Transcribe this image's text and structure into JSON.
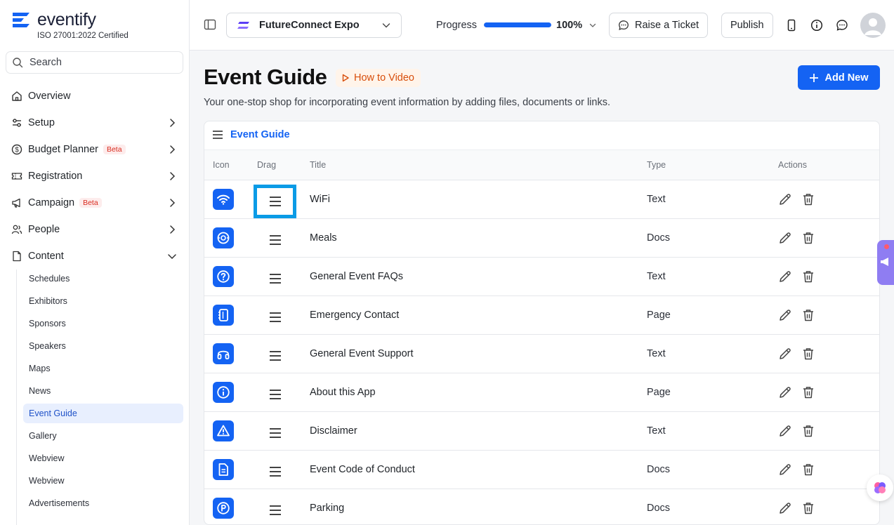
{
  "brand": {
    "name": "eventify",
    "certification": "ISO 27001:2022 Certified"
  },
  "sidebar": {
    "search_placeholder": "Search",
    "items": [
      {
        "label": "Overview",
        "icon": "home-icon"
      },
      {
        "label": "Setup",
        "icon": "sliders-icon"
      },
      {
        "label": "Budget Planner",
        "icon": "dollar-icon",
        "badge": "Beta"
      },
      {
        "label": "Registration",
        "icon": "ticket-icon"
      },
      {
        "label": "Campaign",
        "icon": "megaphone-icon",
        "badge": "Beta"
      },
      {
        "label": "People",
        "icon": "people-icon"
      },
      {
        "label": "Content",
        "icon": "document-icon"
      }
    ],
    "content_subitems": [
      "Schedules",
      "Exhibitors",
      "Sponsors",
      "Speakers",
      "Maps",
      "News",
      "Event Guide",
      "Gallery",
      "Webview",
      "Webview",
      "Advertisements"
    ],
    "active_subitem": "Event Guide"
  },
  "topbar": {
    "event_name": "FutureConnect Expo",
    "progress_label": "Progress",
    "progress_value": "100%",
    "progress_fraction": 1.0,
    "raise_ticket": "Raise a Ticket",
    "publish": "Publish"
  },
  "main": {
    "title": "Event Guide",
    "how_to_video": "How to Video",
    "subtitle": "Your one-stop shop for incorporating event information by adding files, documents or links.",
    "add_new": "Add New",
    "card_title": "Event Guide",
    "columns": {
      "icon": "Icon",
      "drag": "Drag",
      "title": "Title",
      "type": "Type",
      "actions": "Actions"
    },
    "rows": [
      {
        "title": "WiFi",
        "type": "Text",
        "icon": "wifi-icon"
      },
      {
        "title": "Meals",
        "type": "Docs",
        "icon": "meals-icon"
      },
      {
        "title": "General Event FAQs",
        "type": "Text",
        "icon": "question-icon"
      },
      {
        "title": "Emergency Contact",
        "type": "Page",
        "icon": "contact-book-icon"
      },
      {
        "title": "General Event Support",
        "type": "Text",
        "icon": "headphones-icon"
      },
      {
        "title": "About this App",
        "type": "Page",
        "icon": "info-icon"
      },
      {
        "title": "Disclaimer",
        "type": "Text",
        "icon": "warning-icon"
      },
      {
        "title": "Event Code of Conduct",
        "type": "Docs",
        "icon": "file-text-icon"
      },
      {
        "title": "Parking",
        "type": "Docs",
        "icon": "parking-icon"
      }
    ]
  },
  "colors": {
    "accent": "#1463f3",
    "focus_outline": "#0a9be6",
    "beta": "#d92d20",
    "howto": "#d84e0b"
  }
}
